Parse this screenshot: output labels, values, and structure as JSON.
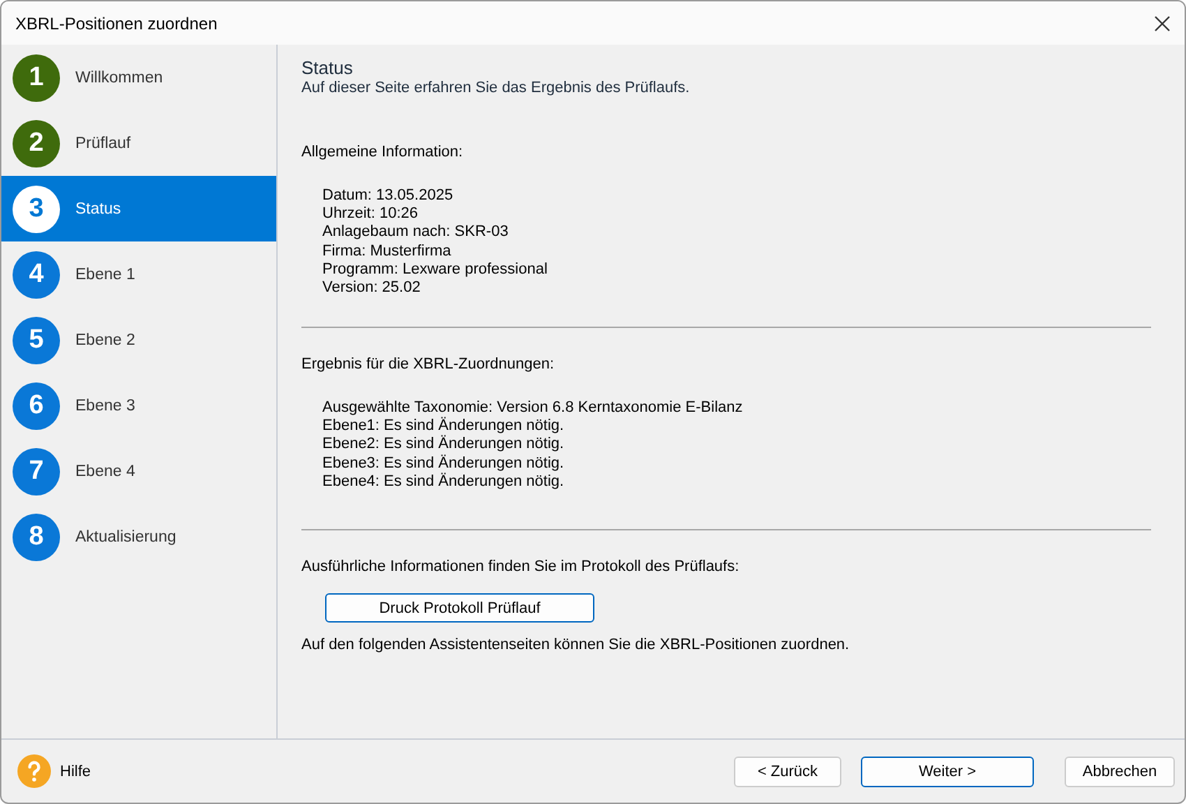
{
  "window": {
    "title": "XBRL-Positionen zuordnen"
  },
  "steps": [
    {
      "number": "1",
      "label": "Willkommen",
      "completed": true,
      "selected": false
    },
    {
      "number": "2",
      "label": "Prüflauf",
      "completed": true,
      "selected": false
    },
    {
      "number": "3",
      "label": "Status",
      "completed": false,
      "selected": true
    },
    {
      "number": "4",
      "label": "Ebene 1",
      "completed": false,
      "selected": false
    },
    {
      "number": "5",
      "label": "Ebene 2",
      "completed": false,
      "selected": false
    },
    {
      "number": "6",
      "label": "Ebene 3",
      "completed": false,
      "selected": false
    },
    {
      "number": "7",
      "label": "Ebene 4",
      "completed": false,
      "selected": false
    },
    {
      "number": "8",
      "label": "Aktualisierung",
      "completed": false,
      "selected": false
    }
  ],
  "page": {
    "title": "Status",
    "subtitle": "Auf dieser Seite erfahren Sie das Ergebnis des Prüflaufs."
  },
  "sections": [
    {
      "heading": "Allgemeine Information:",
      "lines": [
        "Datum: 13.05.2025",
        "Uhrzeit: 10:26",
        "Anlagebaum nach: SKR-03",
        "Firma: Musterfirma",
        "Programm: Lexware professional",
        "Version: 25.02"
      ]
    },
    {
      "heading": "Ergebnis für die XBRL-Zuordnungen:",
      "lines": [
        "Ausgewählte Taxonomie: Version 6.8 Kerntaxonomie E-Bilanz",
        "Ebene1: Es sind Änderungen nötig.",
        "Ebene2: Es sind Änderungen nötig.",
        "Ebene3: Es sind Änderungen nötig.",
        "Ebene4: Es sind Änderungen nötig."
      ]
    },
    {
      "heading": "Ausführliche Informationen finden Sie im Protokoll des Prüflaufs:",
      "button": "Druck Protokoll Prüflauf",
      "note": "Auf den folgenden Assistentenseiten können Sie die XBRL-Positionen zuordnen."
    }
  ],
  "footer": {
    "help": "Hilfe",
    "buttons": [
      {
        "label": "< Zurück",
        "default": false
      },
      {
        "label": "Weiter >",
        "default": true
      },
      {
        "label": "Abbrechen",
        "default": false
      }
    ]
  }
}
